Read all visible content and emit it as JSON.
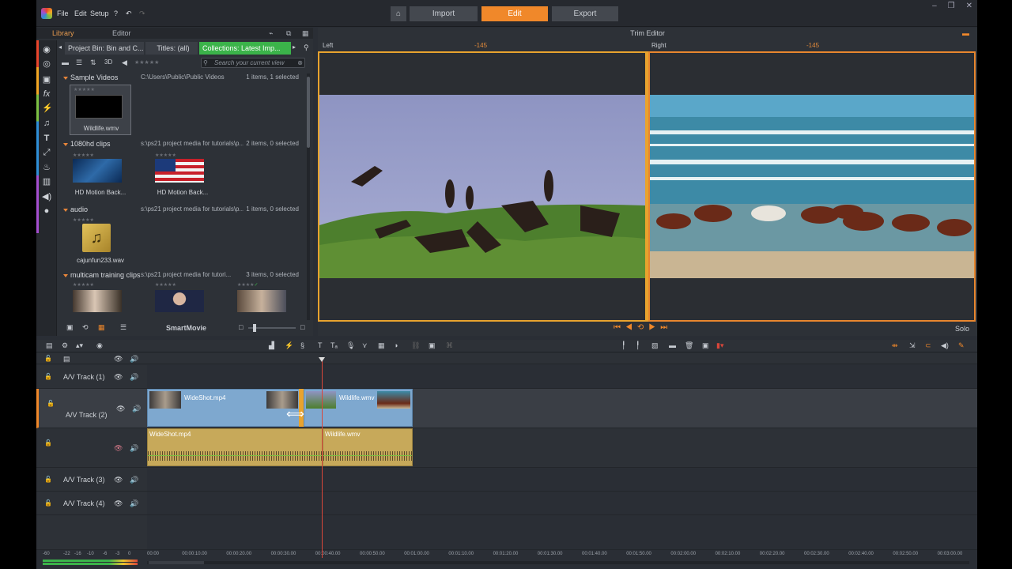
{
  "menu": [
    "File",
    "Edit",
    "Setup"
  ],
  "modes": {
    "import": "Import",
    "edit": "Edit",
    "export": "Export"
  },
  "library": {
    "tab_library": "Library",
    "tab_editor": "Editor",
    "bin_tabs": [
      "Project Bin: Bin and C...",
      "Titles: (all)",
      "Collections: Latest Imp..."
    ],
    "search_placeholder": "Search your current view",
    "view3d": "3D",
    "groups": [
      {
        "name": "Sample Videos",
        "path": "C:\\Users\\Public\\Public Videos",
        "count": "1 items, 1 selected",
        "items": [
          {
            "name": "Wildlife.wmv"
          }
        ]
      },
      {
        "name": "1080hd clips",
        "path": "s:\\ps21 project media for tutorials\\p...",
        "count": "2 items, 0 selected",
        "items": [
          {
            "name": "HD Motion Back..."
          },
          {
            "name": "HD Motion Back..."
          }
        ]
      },
      {
        "name": "audio",
        "path": "s:\\ps21 project media for tutorials\\p...",
        "count": "1 items, 0 selected",
        "items": [
          {
            "name": "cajunfun233.wav"
          }
        ]
      },
      {
        "name": "multicam training clips",
        "path": "s:\\ps21 project media for tutori...",
        "count": "3 items, 0 selected",
        "items": [
          {
            "name": ""
          },
          {
            "name": ""
          },
          {
            "name": ""
          }
        ]
      }
    ],
    "smartmovie": "SmartMovie"
  },
  "trim": {
    "title": "Trim Editor",
    "left_label": "Left",
    "right_label": "Right",
    "left_offset": "-145",
    "right_offset": "-145",
    "solo": "Solo"
  },
  "timeline": {
    "tracks": [
      {
        "label": "A/V Track (1)"
      },
      {
        "label": "A/V Track (2)"
      },
      {
        "label": ""
      },
      {
        "label": "A/V Track (3)"
      },
      {
        "label": "A/V Track (4)"
      }
    ],
    "clips": {
      "video1": "WideShot.mp4",
      "video2": "Wildlife.wmv",
      "audio1": "WideShot.mp4",
      "audio2": "Wildlife.wmv"
    },
    "ruler": [
      "00:00",
      "00:00:10.00",
      "00:00:20.00",
      "00:00:30.00",
      "00:00:40.00",
      "00:00:50.00",
      "00:01:00.00",
      "00:01:10.00",
      "00:01:20.00",
      "00:01:30.00",
      "00:01:40.00",
      "00:01:50.00",
      "00:02:00.00",
      "00:02:10.00",
      "00:02:20.00",
      "00:02:30.00",
      "00:02:40.00",
      "00:02:50.00",
      "00:03:00.00"
    ],
    "vu_labels": [
      "-60",
      "-22",
      "-16",
      "-10",
      "-6",
      "-3",
      "0"
    ]
  },
  "colors": {
    "accent": "#f0882a",
    "green_tab": "#3bb34a",
    "video_clip": "#7ea8cf",
    "audio_clip": "#c7a95a"
  }
}
